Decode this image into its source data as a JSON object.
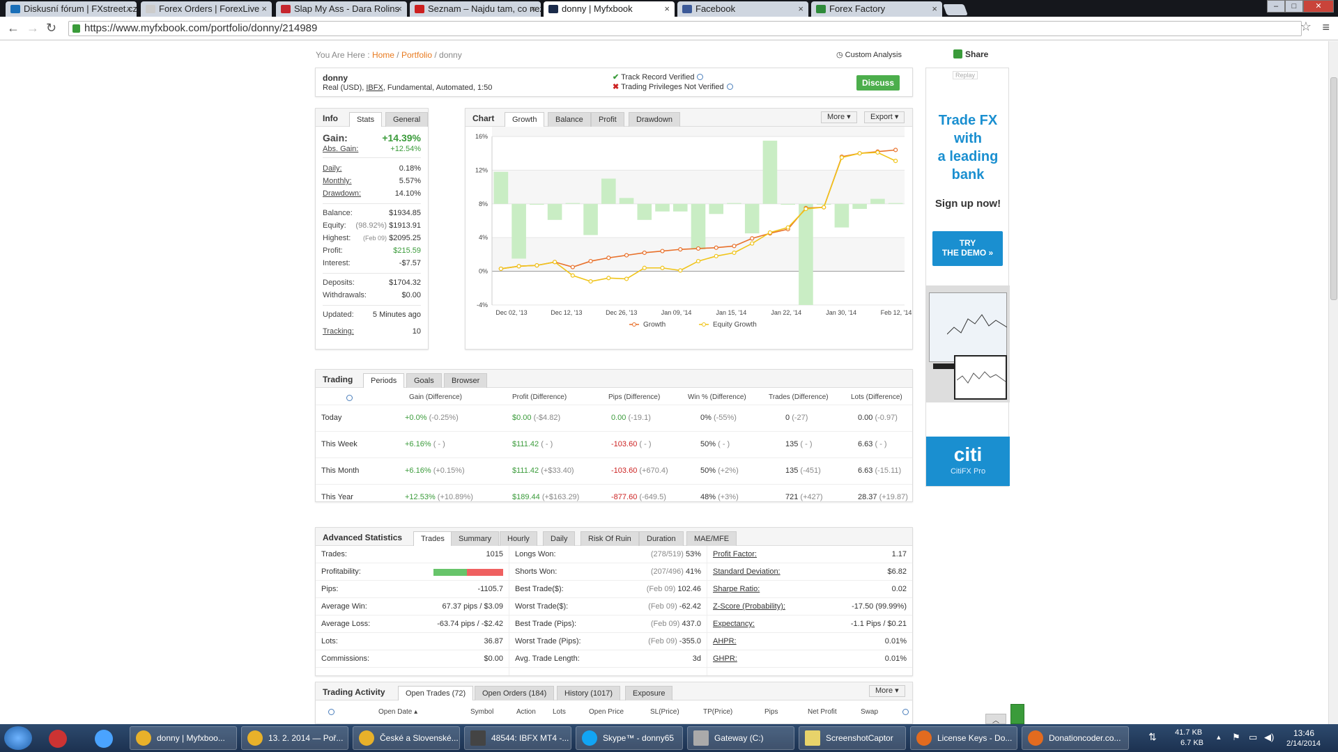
{
  "browser": {
    "tabs": [
      {
        "label": "Diskusní fórum | FXstreet.cz",
        "color": "#1a6fb8"
      },
      {
        "label": "Forex Orders | ForexLive",
        "color": "#cccccc"
      },
      {
        "label": "Slap My Ass - Dara Rolins",
        "color": "#c6262e"
      },
      {
        "label": "Seznam – Najdu tam, co nezn",
        "color": "#cc1f1f"
      },
      {
        "label": "donny | Myfxbook",
        "color": "#1b2b4a"
      },
      {
        "label": "Facebook",
        "color": "#3b5998"
      },
      {
        "label": "Forex Factory",
        "color": "#2e8b3a"
      }
    ],
    "url": "https://www.myfxbook.com/portfolio/donny/214989"
  },
  "breadcrumb": {
    "prefix": "You Are Here :",
    "home": "Home",
    "portfolio": "Portfolio",
    "current": "donny"
  },
  "custom_analysis": "Custom Analysis",
  "share": "Share",
  "account": {
    "name": "donny",
    "desc_pre": "Real (USD),",
    "broker": "IBFX",
    "desc_post": ", Fundamental, Automated, 1:50",
    "track": "Track Record Verified",
    "privileges": "Trading Privileges Not Verified",
    "discuss": "Discuss"
  },
  "info": {
    "tabs": [
      "Info",
      "Stats",
      "General"
    ],
    "gain_label": "Gain:",
    "gain": "+14.39%",
    "abs_gain_label": "Abs. Gain:",
    "abs_gain": "+12.54%",
    "daily_label": "Daily:",
    "daily": "0.18%",
    "monthly_label": "Monthly:",
    "monthly": "5.57%",
    "drawdown_label": "Drawdown:",
    "drawdown": "14.10%",
    "balance_label": "Balance:",
    "balance": "$1934.85",
    "equity_label": "Equity:",
    "equity_pct": "(98.92%)",
    "equity": "$1913.91",
    "highest_label": "Highest:",
    "highest_date": "(Feb 09)",
    "highest": "$2095.25",
    "profit_label": "Profit:",
    "profit": "$215.59",
    "interest_label": "Interest:",
    "interest": "-$7.57",
    "deposits_label": "Deposits:",
    "deposits": "$1704.32",
    "withdrawals_label": "Withdrawals:",
    "withdrawals": "$0.00",
    "updated_label": "Updated:",
    "updated": "5 Minutes ago",
    "tracking_label": "Tracking:",
    "tracking": "10"
  },
  "chart_panel": {
    "tabs": [
      "Chart",
      "Growth",
      "Balance",
      "Profit",
      "Drawdown"
    ],
    "more": "More",
    "export": "Export"
  },
  "chart_data": {
    "type": "line",
    "ylim": [
      -4,
      16
    ],
    "yticks": [
      "-4%",
      "0%",
      "4%",
      "8%",
      "12%",
      "16%"
    ],
    "xticks": [
      "Dec 02, '13",
      "Dec 12, '13",
      "Dec 26, '13",
      "Jan 09, '14",
      "Jan 15, '14",
      "Jan 22, '14",
      "Jan 30, '14",
      "Feb 12, '14"
    ],
    "series": [
      {
        "name": "Growth",
        "color": "#e8702a",
        "values": [
          0.3,
          0.6,
          0.7,
          1.1,
          0.5,
          1.2,
          1.6,
          1.9,
          2.2,
          2.4,
          2.6,
          2.7,
          2.8,
          3.0,
          3.9,
          4.5,
          5.0,
          7.5,
          7.6,
          13.6,
          14.0,
          14.2,
          14.4
        ]
      },
      {
        "name": "Equity Growth",
        "color": "#f0c419",
        "values": [
          0.3,
          0.6,
          0.7,
          1.1,
          -0.5,
          -1.2,
          -0.8,
          -0.9,
          0.4,
          0.4,
          0.1,
          1.2,
          1.8,
          2.2,
          3.3,
          4.6,
          5.2,
          7.4,
          7.6,
          13.5,
          14.0,
          14.1,
          13.1
        ]
      }
    ],
    "bars": [
      11.8,
      1.5,
      7.9,
      6.1,
      8.1,
      4.3,
      11.0,
      8.7,
      6.1,
      7.1,
      7.1,
      2.6,
      6.8,
      8.1,
      4.5,
      15.5,
      7.9,
      -4.0,
      7.9,
      5.2,
      7.4,
      8.6,
      8.1
    ],
    "bar_color": "#c9edc4"
  },
  "trading": {
    "tabs": [
      "Trading",
      "Periods",
      "Goals",
      "Browser"
    ],
    "headers": [
      "Gain (Difference)",
      "Profit (Difference)",
      "Pips (Difference)",
      "Win % (Difference)",
      "Trades (Difference)",
      "Lots (Difference)"
    ],
    "rows": [
      {
        "label": "Today",
        "gain": "+0.0%",
        "gain_d": "(-0.25%)",
        "profit": "$0.00",
        "profit_d": "(-$4.82)",
        "pips": "0.00",
        "pips_d": "(-19.1)",
        "win": "0%",
        "win_d": "(-55%)",
        "trades": "0",
        "trades_d": "(-27)",
        "lots": "0.00",
        "lots_d": "(-0.97)",
        "pips_neg": false
      },
      {
        "label": "This Week",
        "gain": "+6.16%",
        "gain_d": "( - )",
        "profit": "$111.42",
        "profit_d": "( - )",
        "pips": "-103.60",
        "pips_d": "( - )",
        "win": "50%",
        "win_d": "( - )",
        "trades": "135",
        "trades_d": "( - )",
        "lots": "6.63",
        "lots_d": "( - )",
        "pips_neg": true
      },
      {
        "label": "This Month",
        "gain": "+6.16%",
        "gain_d": "(+0.15%)",
        "profit": "$111.42",
        "profit_d": "(+$33.40)",
        "pips": "-103.60",
        "pips_d": "(+670.4)",
        "win": "50%",
        "win_d": "(+2%)",
        "trades": "135",
        "trades_d": "(-451)",
        "lots": "6.63",
        "lots_d": "(-15.11)",
        "pips_neg": true
      },
      {
        "label": "This Year",
        "gain": "+12.53%",
        "gain_d": "(+10.89%)",
        "profit": "$189.44",
        "profit_d": "(+$163.29)",
        "pips": "-877.60",
        "pips_d": "(-649.5)",
        "win": "48%",
        "win_d": "(+3%)",
        "trades": "721",
        "trades_d": "(+427)",
        "lots": "28.37",
        "lots_d": "(+19.87)",
        "pips_neg": true
      }
    ]
  },
  "advanced": {
    "tabs": [
      "Advanced Statistics",
      "Trades",
      "Summary",
      "Hourly",
      "Daily",
      "Risk Of Ruin",
      "Duration",
      "MAE/MFE"
    ],
    "col1": [
      {
        "k": "Trades:",
        "v": "1015"
      },
      {
        "k": "Profitability:",
        "v": ""
      },
      {
        "k": "Pips:",
        "v": "-1105.7"
      },
      {
        "k": "Average Win:",
        "v": "67.37 pips / $3.09"
      },
      {
        "k": "Average Loss:",
        "v": "-63.74 pips / -$2.42"
      },
      {
        "k": "Lots:",
        "v": "36.87"
      },
      {
        "k": "Commissions:",
        "v": "$0.00"
      }
    ],
    "col2": [
      {
        "k": "Longs Won:",
        "m": "(278/519)",
        "v": "53%"
      },
      {
        "k": "Shorts Won:",
        "m": "(207/496)",
        "v": "41%"
      },
      {
        "k": "Best Trade($):",
        "m": "(Feb 09)",
        "v": "102.46"
      },
      {
        "k": "Worst Trade($):",
        "m": "(Feb 09)",
        "v": "-62.42"
      },
      {
        "k": "Best Trade (Pips):",
        "m": "(Feb 09)",
        "v": "437.0"
      },
      {
        "k": "Worst Trade (Pips):",
        "m": "(Feb 09)",
        "v": "-355.0"
      },
      {
        "k": "Avg. Trade Length:",
        "m": "",
        "v": "3d"
      }
    ],
    "col3": [
      {
        "k": "Profit Factor:",
        "v": "1.17"
      },
      {
        "k": "Standard Deviation:",
        "v": "$6.82"
      },
      {
        "k": "Sharpe Ratio:",
        "v": "0.02"
      },
      {
        "k": "Z-Score (Probability):",
        "v": "-17.50 (99.99%)"
      },
      {
        "k": "Expectancy:",
        "v": "-1.1 Pips / $0.21"
      },
      {
        "k": "AHPR:",
        "v": "0.01%"
      },
      {
        "k": "GHPR:",
        "v": "0.01%"
      }
    ],
    "profitability_pct": 48
  },
  "activity": {
    "tabs": [
      "Trading Activity",
      "Open Trades (72)",
      "Open Orders (184)",
      "History (1017)",
      "Exposure"
    ],
    "more": "More",
    "headers": [
      "Open Date",
      "Symbol",
      "Action",
      "Lots",
      "Open Price",
      "SL(Price)",
      "TP(Price)",
      "Pips",
      "Net Profit",
      "Swap"
    ]
  },
  "ad": {
    "replay": "Replay",
    "line1": "Trade FX",
    "line2": "with",
    "line3": "a leading",
    "line4": "bank",
    "signup": "Sign up now!",
    "demo1": "TRY",
    "demo2": "THE DEMO »",
    "brand": "citi",
    "product": "CitiFX Pro"
  },
  "taskbar": {
    "items": [
      "donny | Myfxboo...",
      "13. 2. 2014 — Poř...",
      "České a Slovenské...",
      "48544: IBFX MT4 -...",
      "Skype™ - donny65",
      "Gateway (C:)",
      "ScreenshotCaptor",
      "License Keys - Do...",
      "Donationcoder.co..."
    ],
    "net_down": "41.7 KB",
    "net_up": "6.7 KB",
    "time": "13:46",
    "date": "2/14/2014"
  }
}
